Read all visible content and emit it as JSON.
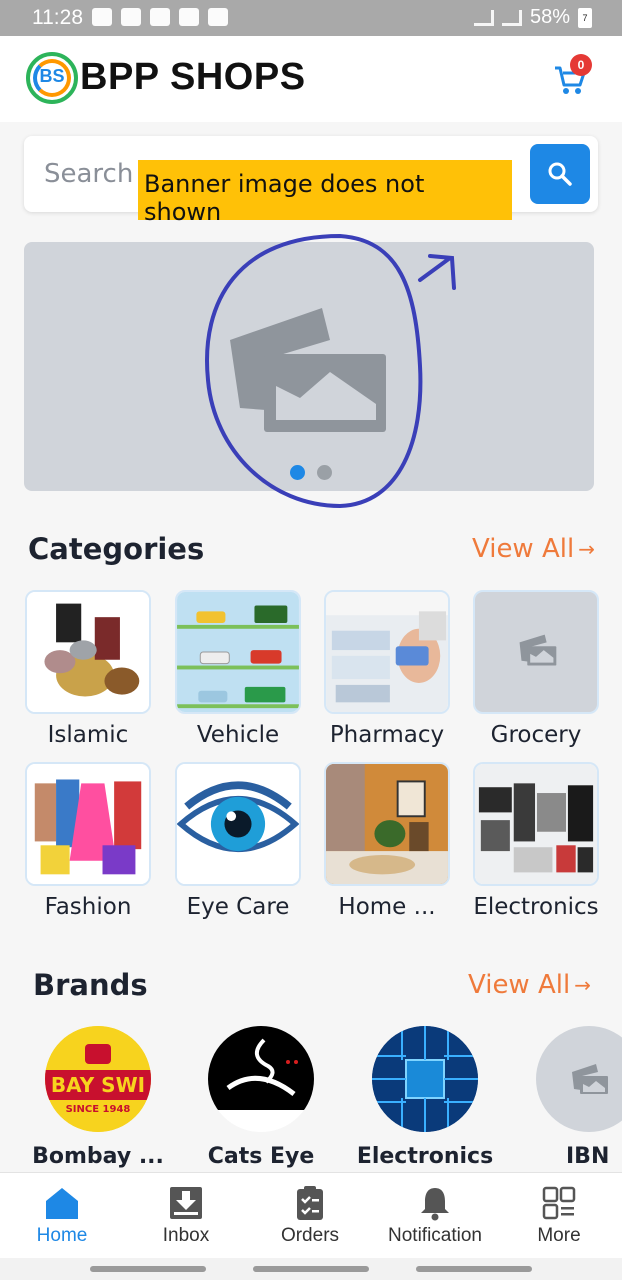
{
  "status_bar": {
    "time": "11:28",
    "battery": "58%",
    "battery_level": "7"
  },
  "header": {
    "title": "BPP SHOPS",
    "logo_text": "BS",
    "cart_count": "0"
  },
  "search": {
    "placeholder": "Search"
  },
  "annotation": {
    "note": "Banner image does not shown"
  },
  "banner": {
    "slides": 2,
    "active_slide": 1
  },
  "categories": {
    "title": "Categories",
    "view_all": "View All",
    "items": [
      {
        "label": "Islamic"
      },
      {
        "label": "Vehicle"
      },
      {
        "label": "Pharmacy"
      },
      {
        "label": "Grocery"
      },
      {
        "label": "Fashion"
      },
      {
        "label": "Eye Care"
      },
      {
        "label": "Home ..."
      },
      {
        "label": "Electronics"
      }
    ]
  },
  "brands": {
    "title": "Brands",
    "view_all": "View All",
    "items": [
      {
        "name": "Bombay ...",
        "logo_text": "BAY SWI",
        "logo_sub": "SINCE 1948"
      },
      {
        "name": "Cats Eye"
      },
      {
        "name": "Electronics"
      },
      {
        "name": "IBN"
      }
    ]
  },
  "bottom_nav": [
    {
      "label": "Home",
      "icon": "home-icon"
    },
    {
      "label": "Inbox",
      "icon": "inbox-icon"
    },
    {
      "label": "Orders",
      "icon": "orders-icon"
    },
    {
      "label": "Notification",
      "icon": "bell-icon"
    },
    {
      "label": "More",
      "icon": "grid-icon"
    }
  ],
  "colors": {
    "accent": "#1e88e5",
    "view_all": "#ef7a3b",
    "badge": "#e53935",
    "annotation": "#ffc107"
  }
}
